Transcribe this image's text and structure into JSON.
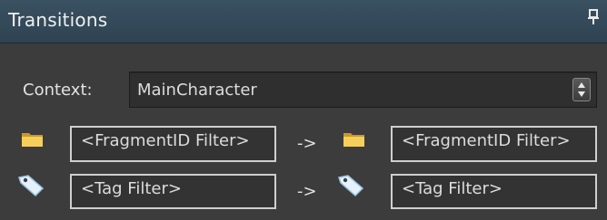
{
  "panel": {
    "title": "Transitions",
    "pin_icon": "pin-icon"
  },
  "context": {
    "label": "Context:",
    "value": "MainCharacter"
  },
  "filters": {
    "fragment_from": {
      "placeholder": "<FragmentID Filter>",
      "icon": "folder-icon"
    },
    "fragment_arrow": "->",
    "fragment_to": {
      "placeholder": "<FragmentID Filter>",
      "icon": "folder-icon"
    },
    "tag_from": {
      "placeholder": "<Tag Filter>",
      "icon": "tag-icon"
    },
    "tag_arrow": "->",
    "tag_to": {
      "placeholder": "<Tag Filter>",
      "icon": "tag-icon"
    }
  },
  "colors": {
    "title_bar": "#34495a",
    "panel_bg": "#3c3c3c",
    "folder": "#f2c94c"
  }
}
